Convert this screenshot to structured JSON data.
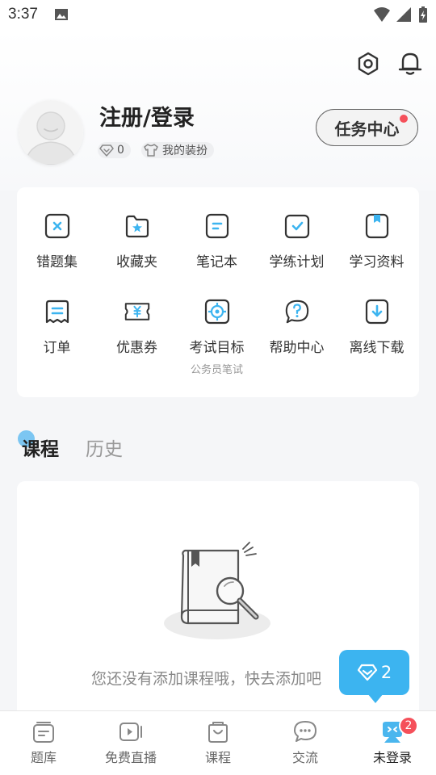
{
  "status_bar": {
    "time": "3:37"
  },
  "header": {
    "title": "注册/登录",
    "points": "0",
    "outfit_label": "我的装扮",
    "task_center": "任务中心"
  },
  "grid": [
    {
      "label": "错题集",
      "icon": "wrong-questions-icon"
    },
    {
      "label": "收藏夹",
      "icon": "favorites-icon"
    },
    {
      "label": "笔记本",
      "icon": "notebook-icon"
    },
    {
      "label": "学练计划",
      "icon": "study-plan-icon"
    },
    {
      "label": "学习资料",
      "icon": "study-materials-icon"
    },
    {
      "label": "订单",
      "icon": "order-icon"
    },
    {
      "label": "优惠券",
      "icon": "coupon-icon"
    },
    {
      "label": "考试目标",
      "icon": "exam-target-icon",
      "sub": "公务员笔试"
    },
    {
      "label": "帮助中心",
      "icon": "help-icon"
    },
    {
      "label": "离线下载",
      "icon": "offline-download-icon"
    }
  ],
  "tabs": [
    {
      "label": "课程"
    },
    {
      "label": "历史"
    }
  ],
  "empty": {
    "message": "您还没有添加课程哦，快去添加吧"
  },
  "floating_badge": {
    "count": "2"
  },
  "nav": [
    {
      "label": "题库",
      "icon": "question-bank-icon"
    },
    {
      "label": "免费直播",
      "icon": "live-icon"
    },
    {
      "label": "课程",
      "icon": "course-icon"
    },
    {
      "label": "交流",
      "icon": "chat-icon"
    },
    {
      "label": "未登录",
      "icon": "mascot-icon",
      "badge": "2"
    }
  ],
  "colors": {
    "accent": "#3cb4f0",
    "badge": "#f5505a",
    "text": "#222222"
  }
}
